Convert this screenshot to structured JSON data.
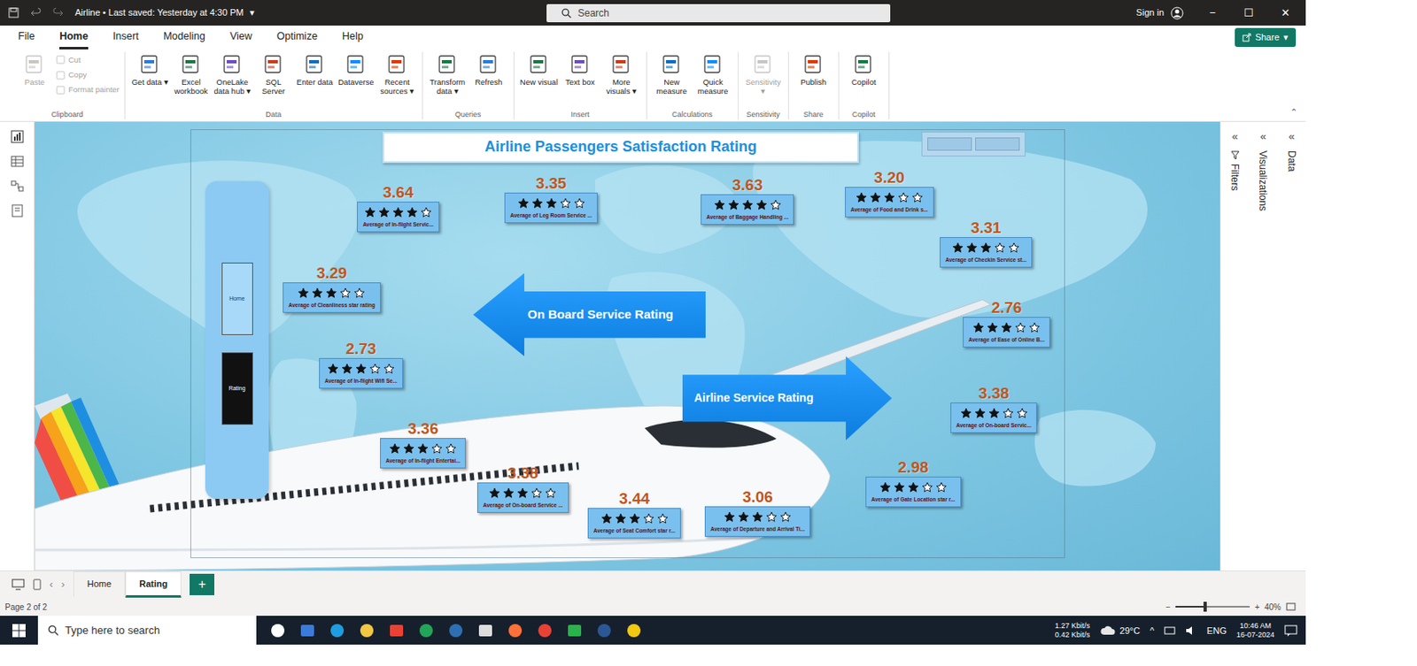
{
  "window": {
    "title": "Airline • Last saved: Yesterday at 4:30 PM",
    "title_arrow": "▾",
    "search": {
      "placeholder": "Search"
    },
    "sign_in": "Sign in",
    "controls": [
      "−",
      "☐",
      "✕"
    ]
  },
  "menu": [
    {
      "label": "File",
      "selected": false
    },
    {
      "label": "Home",
      "selected": true
    },
    {
      "label": "Insert",
      "selected": false
    },
    {
      "label": "Modeling",
      "selected": false
    },
    {
      "label": "View",
      "selected": false
    },
    {
      "label": "Optimize",
      "selected": false
    },
    {
      "label": "Help",
      "selected": false
    }
  ],
  "share": {
    "label": "Share",
    "arrow": "▾"
  },
  "ribbon": [
    {
      "group": "Clipboard",
      "items": [
        {
          "label": "Paste",
          "disabled": true,
          "kind": "large"
        },
        {
          "label": "Cut",
          "disabled": true,
          "kind": "small"
        },
        {
          "label": "Copy",
          "disabled": true,
          "kind": "small"
        },
        {
          "label": "Format painter",
          "disabled": true,
          "kind": "small"
        }
      ]
    },
    {
      "group": "Data",
      "items": [
        {
          "label": "Get data ▾",
          "disabled": false,
          "kind": "large"
        },
        {
          "label": "Excel workbook",
          "disabled": false,
          "kind": "large"
        },
        {
          "label": "OneLake data hub ▾",
          "disabled": false,
          "kind": "large"
        },
        {
          "label": "SQL Server",
          "disabled": false,
          "kind": "large"
        },
        {
          "label": "Enter data",
          "disabled": false,
          "kind": "large"
        },
        {
          "label": "Dataverse",
          "disabled": false,
          "kind": "large"
        },
        {
          "label": "Recent sources ▾",
          "disabled": false,
          "kind": "large"
        }
      ]
    },
    {
      "group": "Queries",
      "items": [
        {
          "label": "Transform data ▾",
          "disabled": false,
          "kind": "large"
        },
        {
          "label": "Refresh",
          "disabled": false,
          "kind": "large"
        }
      ]
    },
    {
      "group": "Insert",
      "items": [
        {
          "label": "New visual",
          "disabled": false,
          "kind": "large"
        },
        {
          "label": "Text box",
          "disabled": false,
          "kind": "large"
        },
        {
          "label": "More visuals ▾",
          "disabled": false,
          "kind": "large"
        }
      ]
    },
    {
      "group": "Calculations",
      "items": [
        {
          "label": "New measure",
          "disabled": false,
          "kind": "large"
        },
        {
          "label": "Quick measure",
          "disabled": false,
          "kind": "large"
        }
      ]
    },
    {
      "group": "Sensitivity",
      "items": [
        {
          "label": "Sensitivity ▾",
          "disabled": true,
          "kind": "large"
        }
      ]
    },
    {
      "group": "Share",
      "items": [
        {
          "label": "Publish",
          "disabled": false,
          "kind": "large"
        }
      ]
    },
    {
      "group": "Copilot",
      "items": [
        {
          "label": "Copilot",
          "disabled": false,
          "kind": "large"
        }
      ]
    }
  ],
  "ribbon_collapse": "⌃",
  "canvas": {
    "title": "Airline Passengers Satisfaction Rating",
    "page_nav": [
      {
        "label": "Home",
        "selected": false
      },
      {
        "label": "Rating",
        "selected": true
      }
    ],
    "arrows": [
      {
        "label": "On Board Service Rating",
        "kind": "left"
      },
      {
        "label": "Airline Service Rating",
        "kind": "right"
      }
    ],
    "ratings": [
      {
        "value": "3.64",
        "stars": 4,
        "label": "Average of In-flight Servic..."
      },
      {
        "value": "3.35",
        "stars": 3,
        "label": "Average of Leg Room Service ..."
      },
      {
        "value": "3.63",
        "stars": 4,
        "label": "Average of Baggage Handling ..."
      },
      {
        "value": "3.20",
        "stars": 3,
        "label": "Average of Food and Drink s..."
      },
      {
        "value": "3.31",
        "stars": 3,
        "label": "Average of Checkin Service st..."
      },
      {
        "value": "3.29",
        "stars": 3,
        "label": "Average of Cleanliness star rating"
      },
      {
        "value": "2.76",
        "stars": 3,
        "label": "Average of Ease of Online B..."
      },
      {
        "value": "2.73",
        "stars": 3,
        "label": "Average of In-flight Wifi Se..."
      },
      {
        "value": "3.38",
        "stars": 3,
        "label": "Average of On-board Servic..."
      },
      {
        "value": "3.36",
        "stars": 3,
        "label": "Average of In-flight Entertai..."
      },
      {
        "value": "3.38",
        "stars": 3,
        "label": "Average of On-board Service ..."
      },
      {
        "value": "3.44",
        "stars": 3,
        "label": "Average of Seat Comfort star r..."
      },
      {
        "value": "3.06",
        "stars": 3,
        "label": "Average of Departure and Arrival Ti..."
      },
      {
        "value": "2.98",
        "stars": 3,
        "label": "Average of Gate Location star r..."
      }
    ]
  },
  "panes": [
    {
      "label": "Filters",
      "expand": "«"
    },
    {
      "label": "Visualizations",
      "expand": "«"
    },
    {
      "label": "Data",
      "expand": "«"
    }
  ],
  "page_tabs": {
    "prev": "‹",
    "next": "›",
    "add": "+",
    "tabs": [
      {
        "label": "Home",
        "selected": false
      },
      {
        "label": "Rating",
        "selected": true
      }
    ]
  },
  "status_bar": {
    "page": "Page 2 of 2",
    "zoom": {
      "minus": "−",
      "plus": "+",
      "level": 0.4,
      "reading": "40%"
    }
  },
  "taskbar": {
    "search": {
      "placeholder": "Type here to search"
    },
    "network": [
      "1.27 Kbit/s",
      "0.42 Kbit/s"
    ],
    "weather": "29°C",
    "tray_arrow": "^",
    "language": "ENG",
    "time": "10:46 AM",
    "date": "16-07-2024"
  }
}
